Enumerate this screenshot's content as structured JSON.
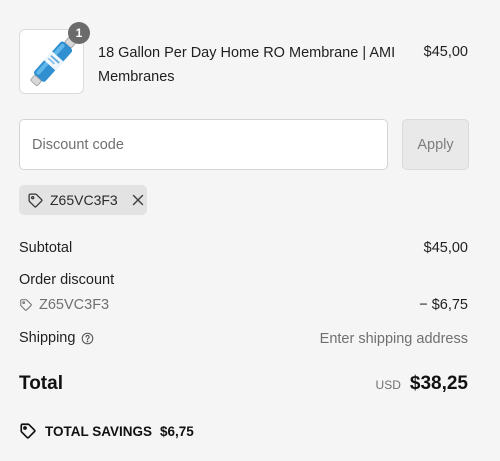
{
  "product": {
    "image_icon": "ro-membrane-filter-image",
    "quantity": "1",
    "title": "18 Gallon Per Day Home RO Membrane | AMI Membranes",
    "price": "$45,00"
  },
  "discount": {
    "placeholder": "Discount code",
    "apply_label": "Apply",
    "applied_code": "Z65VC3F3",
    "tag_icon": "tag-icon",
    "remove_icon": "close-icon"
  },
  "summary": {
    "subtotal_label": "Subtotal",
    "subtotal_value": "$45,00",
    "order_discount_label": "Order discount",
    "discount_code": "Z65VC3F3",
    "discount_value": "− $6,75",
    "shipping_label": "Shipping",
    "shipping_value": "Enter shipping address",
    "shipping_help_icon": "question-circle-icon",
    "total_label": "Total",
    "currency": "USD",
    "total_value": "$38,25",
    "savings_label": "TOTAL SAVINGS",
    "savings_value": "$6,75"
  },
  "colors": {
    "background": "#f5f5f5",
    "badge": "#6b6b6b",
    "chip": "#e3e3e3",
    "apply_disabled": "#e9e9e9",
    "filter_blue": "#2f8fd0"
  }
}
